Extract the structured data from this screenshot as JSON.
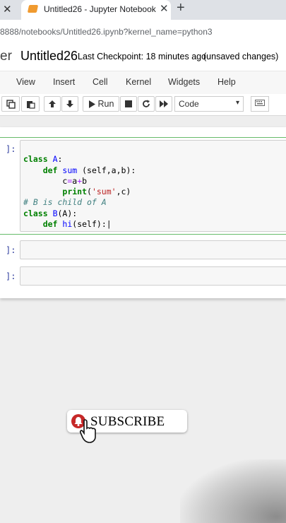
{
  "browser": {
    "prev_tab_close": "✕",
    "tab_title": "Untitled26 - Jupyter Notebook",
    "tab_close": "✕",
    "new_tab": "+",
    "url": "8888/notebooks/Untitled26.ipynb?kernel_name=python3"
  },
  "header": {
    "logo_text": "er",
    "notebook_name": "Untitled26",
    "checkpoint": "Last Checkpoint: 18 minutes ago",
    "unsaved": "(unsaved changes)"
  },
  "menu": {
    "view": "View",
    "insert": "Insert",
    "cell": "Cell",
    "kernel": "Kernel",
    "widgets": "Widgets",
    "help": "Help"
  },
  "toolbar": {
    "run_label": "Run",
    "cell_type": "Code",
    "icons": [
      "copy-icon",
      "paste-icon",
      "move-up-icon",
      "move-down-icon",
      "run-icon",
      "stop-icon",
      "restart-icon",
      "fast-forward-icon",
      "keyboard-icon"
    ]
  },
  "cells": [
    {
      "prompt": "]:",
      "lines": [
        "class A:",
        "    def sum (self,a,b):",
        "        c=a+b",
        "        print('sum',c)",
        "# B is child of A",
        "class B(A):",
        "    def hi(self):"
      ]
    },
    {
      "prompt": "]:",
      "lines": []
    },
    {
      "prompt": "]:",
      "lines": []
    }
  ],
  "overlay": {
    "subscribe_label": "SUBSCRIBE"
  },
  "colors": {
    "selected_cell_border": "#66bb6a",
    "keyword": "#008000",
    "comment": "#408080",
    "string": "#ba2121",
    "tab_icon": "#f09a2f"
  }
}
